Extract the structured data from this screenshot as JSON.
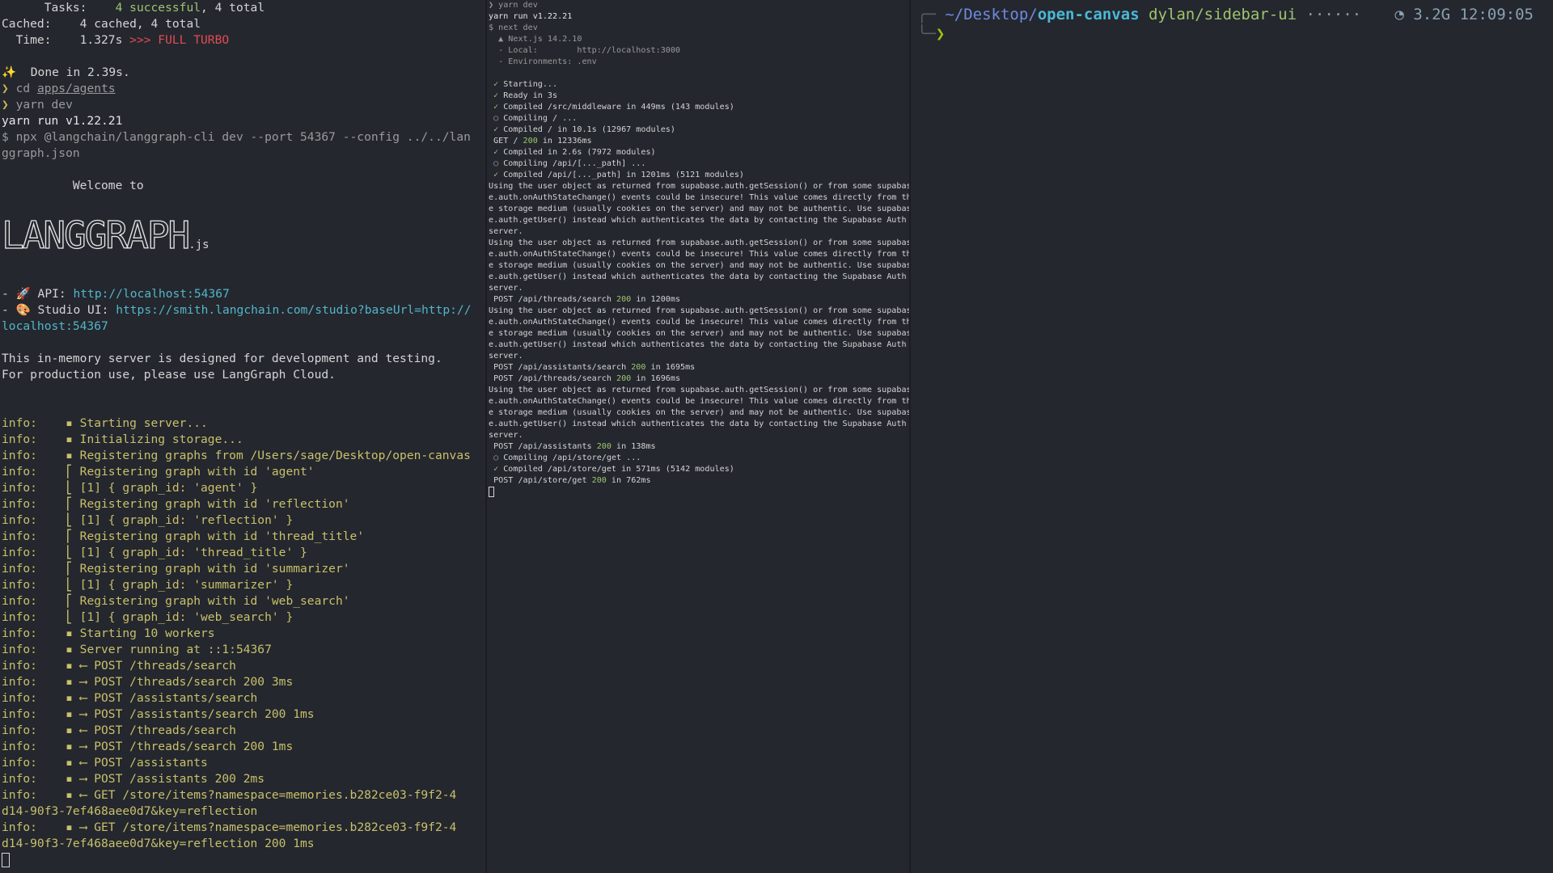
{
  "left_pane": {
    "lines": [
      "      Tasks:    4 successful, 4 total",
      "Cached:    4 cached, 4 total",
      "  Time:    1.327s >>> FULL TURBO",
      "",
      "✨  Done in 2.39s.",
      "❯ cd apps/agents",
      "❯ yarn dev",
      "yarn run v1.22.21",
      "$ npx @langchain/langgraph-cli dev --port 54367 --config ../../lan",
      "ggraph.json",
      "",
      "          Welcome to",
      "",
      "LANGGRAPH.js",
      "",
      "- 🚀 API: http://localhost:54367",
      "- 🎨 Studio UI: https://smith.langchain.com/studio?baseUrl=http://",
      "localhost:54367",
      "",
      "This in-memory server is designed for development and testing.",
      "For production use, please use LangGraph Cloud.",
      "",
      "",
      "info:    ▪ Starting server...",
      "info:    ▪ Initializing storage...",
      "info:    ▪ Registering graphs from /Users/sage/Desktop/open-canvas",
      "info:    ⎡ Registering graph with id 'agent'",
      "info:    ⎣ [1] { graph_id: 'agent' }",
      "info:    ⎡ Registering graph with id 'reflection'",
      "info:    ⎣ [1] { graph_id: 'reflection' }",
      "info:    ⎡ Registering graph with id 'thread_title'",
      "info:    ⎣ [1] { graph_id: 'thread_title' }",
      "info:    ⎡ Registering graph with id 'summarizer'",
      "info:    ⎣ [1] { graph_id: 'summarizer' }",
      "info:    ⎡ Registering graph with id 'web_search'",
      "info:    ⎣ [1] { graph_id: 'web_search' }",
      "info:    ▪ Starting 10 workers",
      "info:    ▪ Server running at ::1:54367",
      "info:    ▪ ⟵ POST /threads/search",
      "info:    ▪ ⟶ POST /threads/search 200 3ms",
      "info:    ▪ ⟵ POST /assistants/search",
      "info:    ▪ ⟶ POST /assistants/search 200 1ms",
      "info:    ▪ ⟵ POST /threads/search",
      "info:    ▪ ⟶ POST /threads/search 200 1ms",
      "info:    ▪ ⟵ POST /assistants",
      "info:    ▪ ⟶ POST /assistants 200 2ms",
      "info:    ▪ ⟵ GET /store/items?namespace=memories.b282ce03-f9f2-4",
      "d14-90f3-7ef468aee0d7&key=reflection",
      "info:    ▪ ⟶ GET /store/items?namespace=memories.b282ce03-f9f2-4",
      "d14-90f3-7ef468aee0d7&key=reflection 200 1ms"
    ]
  },
  "middle_pane": {
    "lines": [
      "❯ yarn dev",
      "yarn run v1.22.21",
      "$ next dev",
      "  ▲ Next.js 14.2.10",
      "  - Local:        http://localhost:3000",
      "  - Environments: .env",
      "",
      " ✓ Starting...",
      " ✓ Ready in 3s",
      " ✓ Compiled /src/middleware in 449ms (143 modules)",
      " ○ Compiling / ...",
      " ✓ Compiled / in 10.1s (12967 modules)",
      " GET / 200 in 12336ms",
      " ✓ Compiled in 2.6s (7972 modules)",
      " ○ Compiling /api/[..._path] ...",
      " ✓ Compiled /api/[..._path] in 1201ms (5121 modules)",
      "Using the user object as returned from supabase.auth.getSession() or from some supabas",
      "e.auth.onAuthStateChange() events could be insecure! This value comes directly from th",
      "e storage medium (usually cookies on the server) and may not be authentic. Use supabas",
      "e.auth.getUser() instead which authenticates the data by contacting the Supabase Auth",
      "server.",
      "Using the user object as returned from supabase.auth.getSession() or from some supabas",
      "e.auth.onAuthStateChange() events could be insecure! This value comes directly from th",
      "e storage medium (usually cookies on the server) and may not be authentic. Use supabas",
      "e.auth.getUser() instead which authenticates the data by contacting the Supabase Auth",
      "server.",
      " POST /api/threads/search 200 in 1200ms",
      "Using the user object as returned from supabase.auth.getSession() or from some supabas",
      "e.auth.onAuthStateChange() events could be insecure! This value comes directly from th",
      "e storage medium (usually cookies on the server) and may not be authentic. Use supabas",
      "e.auth.getUser() instead which authenticates the data by contacting the Supabase Auth",
      "server.",
      " POST /api/assistants/search 200 in 1695ms",
      " POST /api/threads/search 200 in 1696ms",
      "Using the user object as returned from supabase.auth.getSession() or from some supabas",
      "e.auth.onAuthStateChange() events could be insecure! This value comes directly from th",
      "e storage medium (usually cookies on the server) and may not be authentic. Use supabas",
      "e.auth.getUser() instead which authenticates the data by contacting the Supabase Auth",
      "server.",
      " POST /api/assistants 200 in 138ms",
      " ○ Compiling /api/store/get ...",
      " ✓ Compiled /api/store/get in 571ms (5142 modules)",
      " POST /api/store/get 200 in 762ms"
    ]
  },
  "right_pane": {
    "path_prefix": "~/Desktop/",
    "path_dir": "open-canvas",
    "branch": "dylan/sidebar-ui",
    "dots": " ······",
    "mem": "3.2G",
    "time": "12:09:05",
    "prompt_symbol": "❯"
  },
  "colors": {
    "background": "#24272e",
    "info": "#c9c06a",
    "url": "#53b5c9",
    "success": "#9fc46f",
    "turbo": "#e24b53"
  }
}
